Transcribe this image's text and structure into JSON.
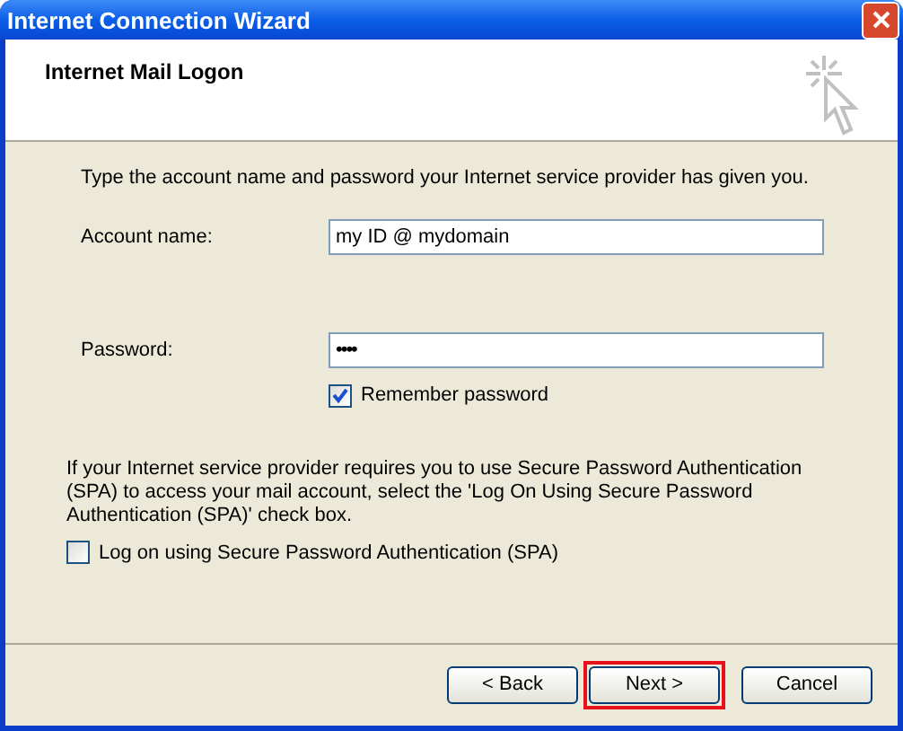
{
  "window": {
    "title": "Internet Connection Wizard"
  },
  "header": {
    "title": "Internet Mail Logon"
  },
  "intro": "Type the account name and password your Internet service provider has given you.",
  "fields": [
    {
      "label": "Account name:",
      "value": "my ID @ mydomain",
      "kind": "text"
    },
    {
      "label": "Password:",
      "value": "••••",
      "kind": "password"
    }
  ],
  "remember": {
    "label": "Remember password",
    "checked": true
  },
  "spa_note": "If your Internet service provider requires you to use Secure Password Authentication (SPA) to access your mail account, select the 'Log On Using Secure Password Authentication (SPA)' check box.",
  "spa": {
    "label": "Log on using Secure Password Authentication (SPA)",
    "checked": false
  },
  "buttons": [
    {
      "label": "< Back",
      "highlighted": false
    },
    {
      "label": "Next >",
      "highlighted": true
    },
    {
      "label": "Cancel",
      "highlighted": false
    }
  ]
}
